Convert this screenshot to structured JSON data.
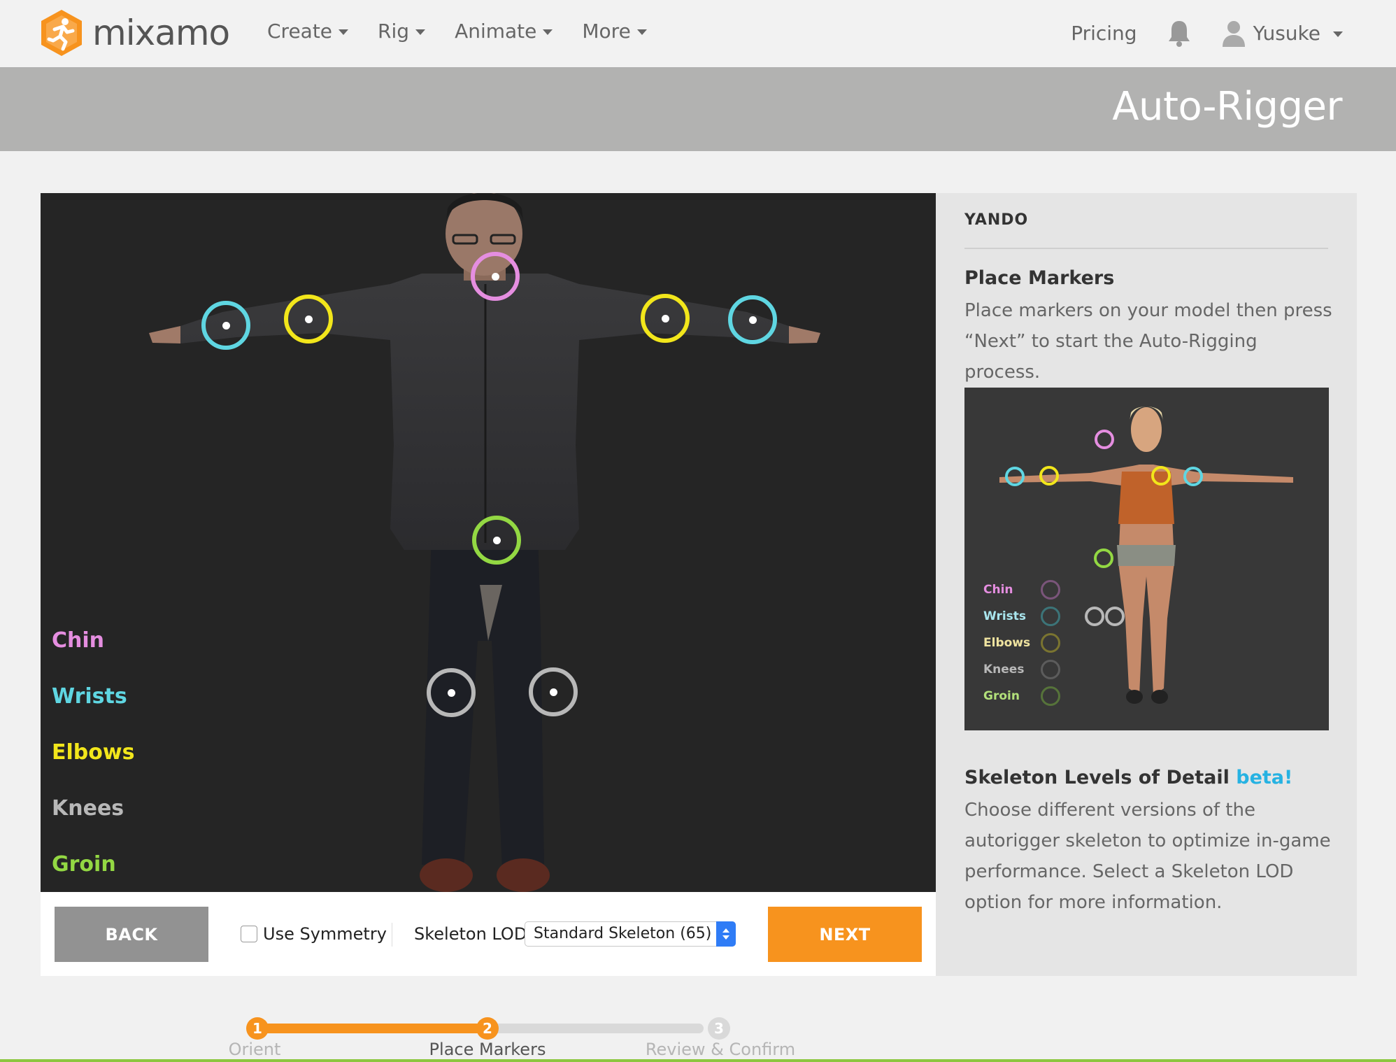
{
  "brand": {
    "name": "mixamo",
    "accent": "#f7931e"
  },
  "nav": {
    "items": [
      {
        "label": "Create"
      },
      {
        "label": "Rig"
      },
      {
        "label": "Animate"
      },
      {
        "label": "More"
      }
    ],
    "pricing": "Pricing",
    "user": "Yusuke"
  },
  "page": {
    "title": "Auto-Rigger"
  },
  "legend": [
    {
      "label": "Chin",
      "color": "#e58ee0"
    },
    {
      "label": "Wrists",
      "color": "#5fd6e2"
    },
    {
      "label": "Elbows",
      "color": "#f2e61b"
    },
    {
      "label": "Knees",
      "color": "#b8b8b8"
    },
    {
      "label": "Groin",
      "color": "#93d843"
    }
  ],
  "controls": {
    "back": "BACK",
    "next": "NEXT",
    "symmetry": "Use Symmetry",
    "symmetry_checked": false,
    "lod_label": "Skeleton LOD",
    "lod_value": "Standard Skeleton (65)"
  },
  "side": {
    "model_name": "YANDO",
    "place_title": "Place Markers",
    "place_text": "Place markers on your model then press “Next” to start the Auto-Rigging process.",
    "lod_title": "Skeleton Levels of Detail",
    "lod_badge": "beta!",
    "lod_text": "Choose different versions of the autorigger skeleton to optimize in-game performance. Select a Skeleton LOD option for more information."
  },
  "steps": [
    {
      "num": "1",
      "label": "Orient",
      "state": "done"
    },
    {
      "num": "2",
      "label": "Place Markers",
      "state": "current"
    },
    {
      "num": "3",
      "label": "Review & Confirm",
      "state": "upcoming"
    }
  ]
}
